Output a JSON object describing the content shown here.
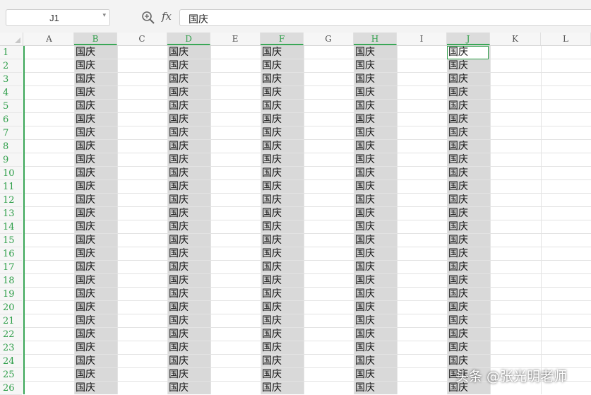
{
  "name_box": {
    "value": "J1",
    "dropdown_icon": "chevron-down-icon"
  },
  "toolbar": {
    "zoom_icon": "zoom-search-icon",
    "fx_label": "fx"
  },
  "formula_bar": {
    "value": "国庆"
  },
  "columns": [
    "A",
    "B",
    "C",
    "D",
    "E",
    "F",
    "G",
    "H",
    "I",
    "J",
    "K",
    "L"
  ],
  "selected_columns": [
    "B",
    "D",
    "F",
    "H",
    "J"
  ],
  "rows": [
    "1",
    "2",
    "3",
    "4",
    "5",
    "6",
    "7",
    "8",
    "9",
    "10",
    "11",
    "12",
    "13",
    "14",
    "15",
    "16",
    "17",
    "18",
    "19",
    "20",
    "21",
    "22",
    "23",
    "24",
    "25",
    "26"
  ],
  "cell_text": "国庆",
  "active_cell": "J1",
  "accent_color": "#3aa757",
  "selection_color": "#d9d9d9",
  "watermark": "头条 @张光明老师"
}
